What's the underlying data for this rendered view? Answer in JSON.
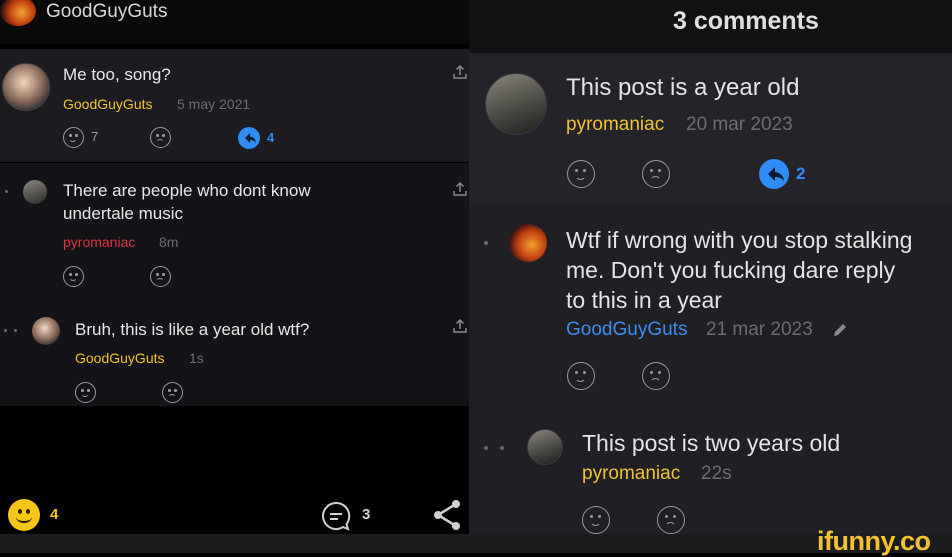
{
  "left_screenshot": {
    "header": {
      "username": "GoodGuyGuts"
    },
    "comments": [
      {
        "text": "Me too, song?",
        "author": "GoodGuyGuts",
        "time": "5 may 2021",
        "reply_count": "7",
        "badge_count": "4"
      },
      {
        "text_line1": "There are people who dont know",
        "text_line2": "undertale music",
        "author": "pyromaniac",
        "time": "8m"
      },
      {
        "text": "Bruh, this is like a year old wtf?",
        "author": "GoodGuyGuts",
        "time": "1s"
      }
    ],
    "footer": {
      "smile_count": "4",
      "comment_count": "3"
    }
  },
  "right_screenshot": {
    "header": {
      "title": "3 comments"
    },
    "comments": [
      {
        "text": "This post is a year old",
        "author": "pyromaniac",
        "time": "20 mar 2023",
        "badge_count": "2"
      },
      {
        "text_line1": "Wtf if wrong with you stop stalking",
        "text_line2": "me. Don't you fucking dare reply",
        "text_line3": "to this in a year",
        "author": "GoodGuyGuts",
        "time": "21 mar 2023"
      },
      {
        "text": "This post is two years old",
        "author": "pyromaniac",
        "time": "22s"
      }
    ],
    "watermark": "ifunny.co"
  },
  "colors": {
    "accent_yellow": "#f2c230",
    "accent_blue": "#2f8cf5",
    "accent_red": "#d8323c"
  },
  "icons": [
    "smile-icon",
    "frown-icon",
    "reply-badge-icon",
    "share-icon",
    "comment-bubble-icon",
    "edit-pencil-icon"
  ]
}
